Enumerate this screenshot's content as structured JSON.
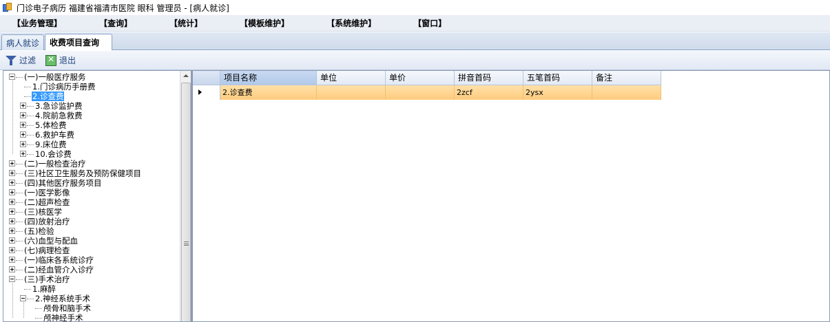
{
  "window": {
    "title": "门诊电子病历  福建省福清市医院  眼科  管理员 - [病人就诊]"
  },
  "menu": [
    "【业务管理】",
    "【查询】",
    "【统计】",
    "【模板维护】",
    "【系统维护】",
    "【窗口】"
  ],
  "tabs": [
    {
      "label": "病人就诊"
    },
    {
      "label": "收费项目查询"
    }
  ],
  "toolbar": {
    "filter_label": "过滤",
    "exit_label": "退出"
  },
  "tree": [
    {
      "label": "(一)一般医疗服务",
      "toggle": "minus"
    },
    {
      "label": "1.门诊病历手册费",
      "toggle": null
    },
    {
      "label": "2.诊查费",
      "toggle": null,
      "selected": true
    },
    {
      "label": "3.急诊监护费",
      "toggle": "plus"
    },
    {
      "label": "4.院前急救费",
      "toggle": "plus"
    },
    {
      "label": "5.体检费",
      "toggle": "plus"
    },
    {
      "label": "6.救护车费",
      "toggle": "plus"
    },
    {
      "label": "9.床位费",
      "toggle": "plus"
    },
    {
      "label": "10.会诊费",
      "toggle": "plus"
    },
    {
      "label": "(二)一般检查治疗",
      "toggle": "plus"
    },
    {
      "label": "(三)社区卫生服务及预防保健项目",
      "toggle": "plus"
    },
    {
      "label": "(四)其他医疗服务项目",
      "toggle": "plus"
    },
    {
      "label": "(一)医学影像",
      "toggle": "plus"
    },
    {
      "label": "(二)超声检查",
      "toggle": "plus"
    },
    {
      "label": "(三)核医学",
      "toggle": "plus"
    },
    {
      "label": "(四)放射治疗",
      "toggle": "plus"
    },
    {
      "label": "(五)检验",
      "toggle": "plus"
    },
    {
      "label": "(六)血型与配血",
      "toggle": "plus"
    },
    {
      "label": "(七)病理检查",
      "toggle": "plus"
    },
    {
      "label": "(一)临床各系统诊疗",
      "toggle": "plus"
    },
    {
      "label": "(二)经血管介入诊疗",
      "toggle": "plus"
    },
    {
      "label": "(三)手术治疗",
      "toggle": "minus"
    },
    {
      "label": "1.麻醉",
      "toggle": null
    },
    {
      "label": "2.神经系统手术",
      "toggle": "minus"
    },
    {
      "label": "颅骨和脑手术",
      "toggle": null
    },
    {
      "label": "颅神经手术",
      "toggle": null
    }
  ],
  "grid": {
    "columns": [
      "项目名称",
      "单位",
      "单价",
      "拼音首码",
      "五笔首码",
      "备注"
    ],
    "rows": [
      {
        "name": "2.诊查费",
        "unit": "",
        "price": "",
        "pinyin": "2zcf",
        "wubi": "2ysx",
        "note": ""
      }
    ]
  }
}
